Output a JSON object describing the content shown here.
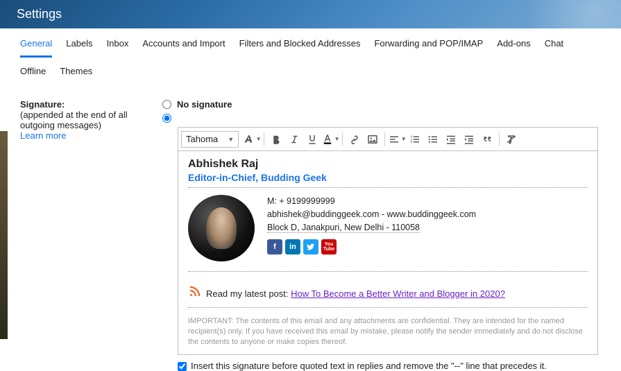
{
  "header": {
    "title": "Settings"
  },
  "tabs": {
    "row1": [
      "General",
      "Labels",
      "Inbox",
      "Accounts and Import",
      "Filters and Blocked Addresses",
      "Forwarding and POP/IMAP",
      "Add-ons",
      "Chat"
    ],
    "row2": [
      "Offline",
      "Themes"
    ],
    "active": "General"
  },
  "left": {
    "label": "Signature:",
    "desc": "(appended at the end of all outgoing messages)",
    "learn_more": "Learn more"
  },
  "signature": {
    "no_sig_label": "No signature",
    "font": "Tahoma",
    "name": "Abhishek Raj",
    "title": "Editor-in-Chief, Budding Geek",
    "mobile": "M: + 9199999999",
    "email": "abhishek@buddinggeek.com",
    "sep": " - ",
    "website": "www.buddinggeek.com",
    "address": "Block D, Janakpuri, New Delhi - 110058",
    "rss_prefix": "Read my latest post: ",
    "rss_link": "How To Become a Better Writer and Blogger in 2020?",
    "disclaimer": "IMPORTANT: The contents of this email and any attachments are confidential. They are intended for the named recipient(s) only. If you have received this email by mistake, please notify the sender immediately and do not disclose the contents to anyone or make copies thereof."
  },
  "insert_checkbox_label": "Insert this signature before quoted text in replies and remove the \"--\" line that precedes it."
}
